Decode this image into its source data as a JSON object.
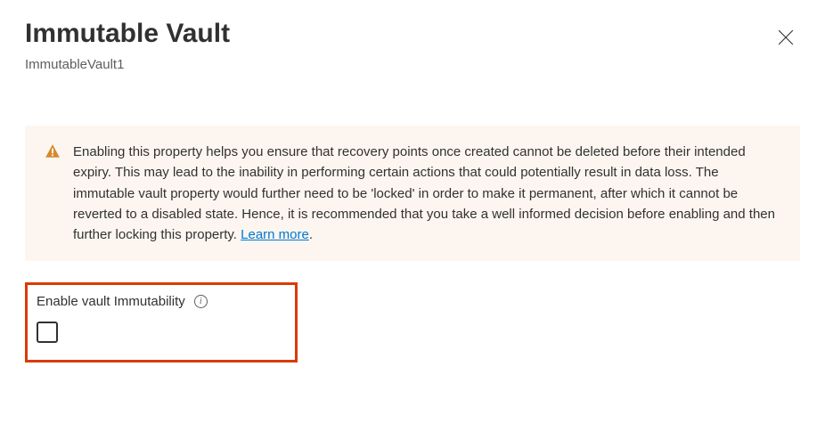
{
  "header": {
    "title": "Immutable Vault",
    "subtitle": "ImmutableVault1"
  },
  "warning": {
    "text": "Enabling this property helps you ensure that recovery points once created cannot be deleted before their intended expiry. This may lead to the inability in performing certain actions that could potentially result in data loss. The immutable vault property would further need to be 'locked' in order to make it permanent, after which it cannot be reverted to a disabled state. Hence, it is recommended that you take a well informed decision before enabling and then further locking this property. ",
    "learn_more": "Learn more"
  },
  "form": {
    "enable_label": "Enable vault Immutability",
    "checked": false
  }
}
